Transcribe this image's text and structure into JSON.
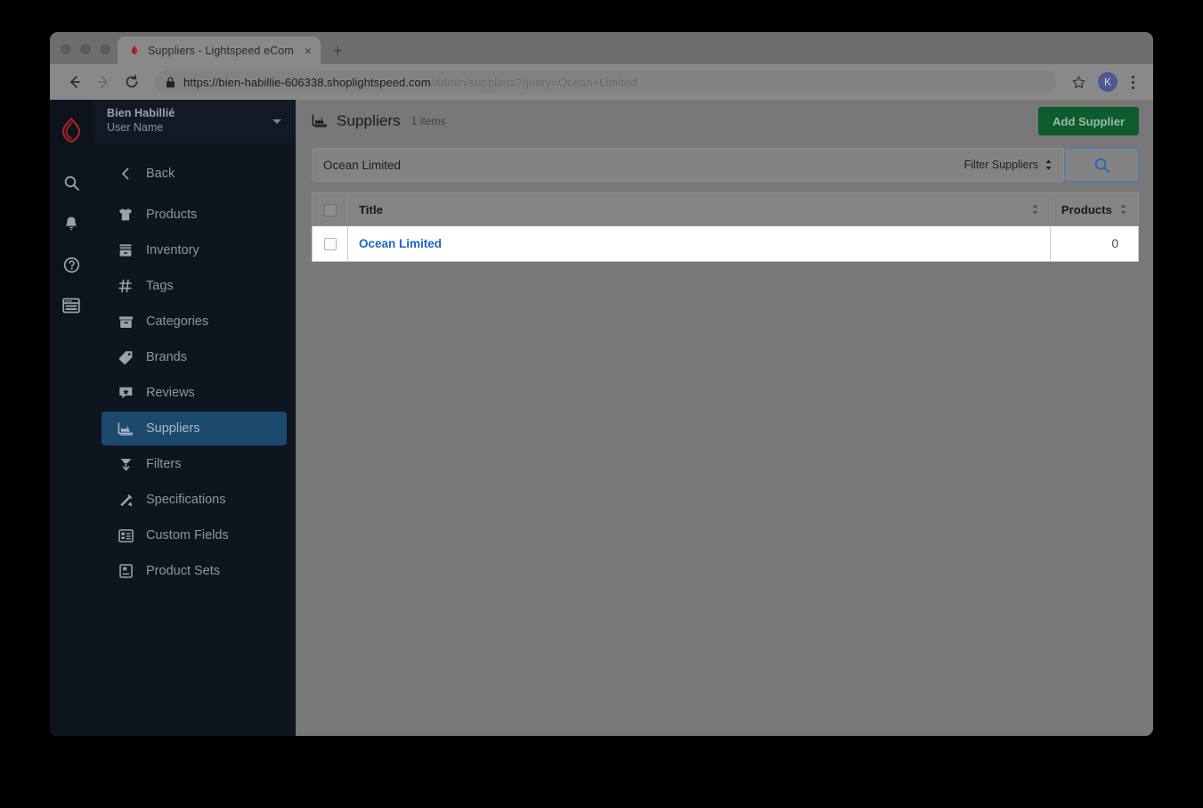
{
  "browser": {
    "tab": {
      "title": "Suppliers - Lightspeed eCom",
      "favicon": "lightspeed-flame-icon",
      "close_label": "×"
    },
    "new_tab_label": "+",
    "nav": {
      "back": "←",
      "forward": "→",
      "reload": "↻"
    },
    "url": {
      "full": "https://bien-habillie-606338.shoplightspeed.com/admin/suppliers?query=Ocean+Limited",
      "dark_part": "https://bien-habillie-606338.shoplightspeed.com",
      "light_part": "/admin/suppliers?query=Ocean+Limited",
      "lock_icon": "padlock-icon"
    },
    "bookmark_icon": "star-icon",
    "profile_initial": "K",
    "menu_icon": "kebab-menu-icon"
  },
  "rail": {
    "logo": "lightspeed-flame-logo",
    "icons": [
      {
        "name": "search-icon",
        "label": "Search"
      },
      {
        "name": "bell-icon",
        "label": "Notifications"
      },
      {
        "name": "help-circle-icon",
        "label": "Help"
      },
      {
        "name": "browser-window-icon",
        "label": "Storefront"
      }
    ]
  },
  "sidebar": {
    "shop_name": "Bien Habillié",
    "user_name": "User Name",
    "switcher_icon": "chevron-down-icon",
    "items": [
      {
        "label": "Back",
        "icon": "chevron-left-icon",
        "active": false
      },
      {
        "label": "Products",
        "icon": "tshirt-icon",
        "active": false
      },
      {
        "label": "Inventory",
        "icon": "drawer-icon",
        "active": false
      },
      {
        "label": "Tags",
        "icon": "hash-icon",
        "active": false
      },
      {
        "label": "Categories",
        "icon": "archive-box-icon",
        "active": false
      },
      {
        "label": "Brands",
        "icon": "tag-icon",
        "active": false
      },
      {
        "label": "Reviews",
        "icon": "comment-star-icon",
        "active": false
      },
      {
        "label": "Suppliers",
        "icon": "factory-icon",
        "active": true
      },
      {
        "label": "Filters",
        "icon": "funnel-icon",
        "active": false
      },
      {
        "label": "Specifications",
        "icon": "tools-icon",
        "active": false
      },
      {
        "label": "Custom Fields",
        "icon": "form-fields-icon",
        "active": false
      },
      {
        "label": "Product Sets",
        "icon": "product-set-icon",
        "active": false
      }
    ]
  },
  "main": {
    "title": "Suppliers",
    "title_icon": "factory-icon",
    "item_count": "1 items",
    "add_button": "Add Supplier",
    "search": {
      "value": "Ocean Limited",
      "placeholder": "",
      "filter_label": "Filter Suppliers",
      "filter_icon": "updown-arrows-icon",
      "submit_icon": "search-icon"
    },
    "table": {
      "columns": [
        "Title",
        "Products"
      ],
      "select_all_checkbox": false,
      "rows": [
        {
          "checked": false,
          "title": "Ocean Limited",
          "products": "0"
        }
      ]
    }
  },
  "colors": {
    "sidebar_bg": "#0e151e",
    "rail_bg": "#0c131c",
    "active_nav": "#1b4a6e",
    "add_button": "#0c5c2d",
    "link": "#1a66c4",
    "content_bg": "#787878",
    "brand_red": "#9e2327"
  }
}
